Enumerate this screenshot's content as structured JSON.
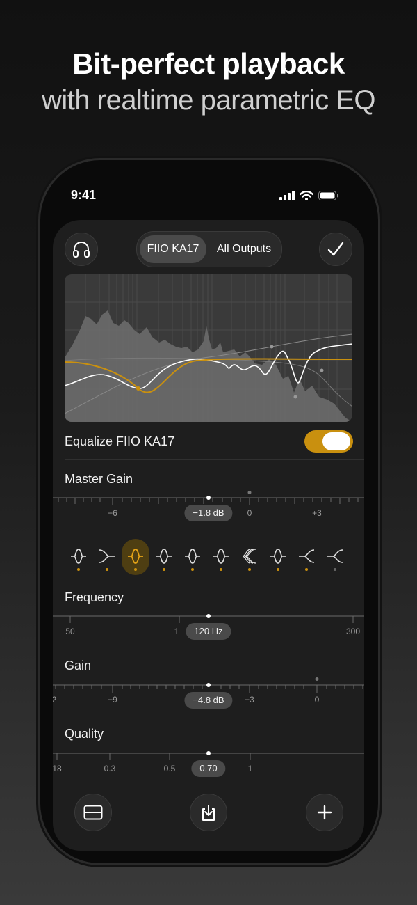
{
  "hero": {
    "title": "Bit-perfect playback",
    "subtitle": "with realtime parametric EQ"
  },
  "status_bar": {
    "time": "9:41",
    "icons": [
      "signal-icon",
      "wifi-icon",
      "battery-icon"
    ]
  },
  "header": {
    "left_icon": "headphones-icon",
    "right_icon": "checkmark-icon",
    "segments": [
      {
        "label": "FIIO KA17",
        "selected": true
      },
      {
        "label": "All Outputs",
        "selected": false
      }
    ]
  },
  "equalize": {
    "label": "Equalize FIIO KA17",
    "enabled": true
  },
  "master_gain": {
    "label": "Master Gain",
    "value": "−1.8 dB",
    "ticks": [
      "−6",
      "0",
      "+3"
    ]
  },
  "bands": [
    {
      "icon": "peak-filter-icon",
      "active": false,
      "enabled": true
    },
    {
      "icon": "high-shelf-icon",
      "active": false,
      "enabled": true
    },
    {
      "icon": "peak-filter-icon",
      "active": true,
      "enabled": true
    },
    {
      "icon": "peak-filter-icon",
      "active": false,
      "enabled": true
    },
    {
      "icon": "peak-filter-icon",
      "active": false,
      "enabled": true
    },
    {
      "icon": "peak-filter-icon",
      "active": false,
      "enabled": true
    },
    {
      "icon": "multi-peak-icon",
      "active": false,
      "enabled": true
    },
    {
      "icon": "peak-filter-icon",
      "active": false,
      "enabled": true
    },
    {
      "icon": "low-shelf-icon",
      "active": false,
      "enabled": true
    },
    {
      "icon": "low-shelf-icon",
      "active": false,
      "enabled": false
    }
  ],
  "frequency": {
    "label": "Frequency",
    "value": "120 Hz",
    "ticks": [
      "50",
      "1",
      "300"
    ]
  },
  "gain": {
    "label": "Gain",
    "value": "−4.8 dB",
    "ticks": [
      "2",
      "−9",
      "−3",
      "0"
    ]
  },
  "quality": {
    "label": "Quality",
    "value": "0.70",
    "ticks": [
      "18",
      "0.3",
      "0.5",
      "1"
    ]
  },
  "bottom_bar": {
    "icons": [
      "layout-icon",
      "import-icon",
      "add-icon"
    ]
  },
  "colors": {
    "accent": "#c9900f",
    "background": "#1e1e1e",
    "eq_curve": "#ffffff"
  }
}
